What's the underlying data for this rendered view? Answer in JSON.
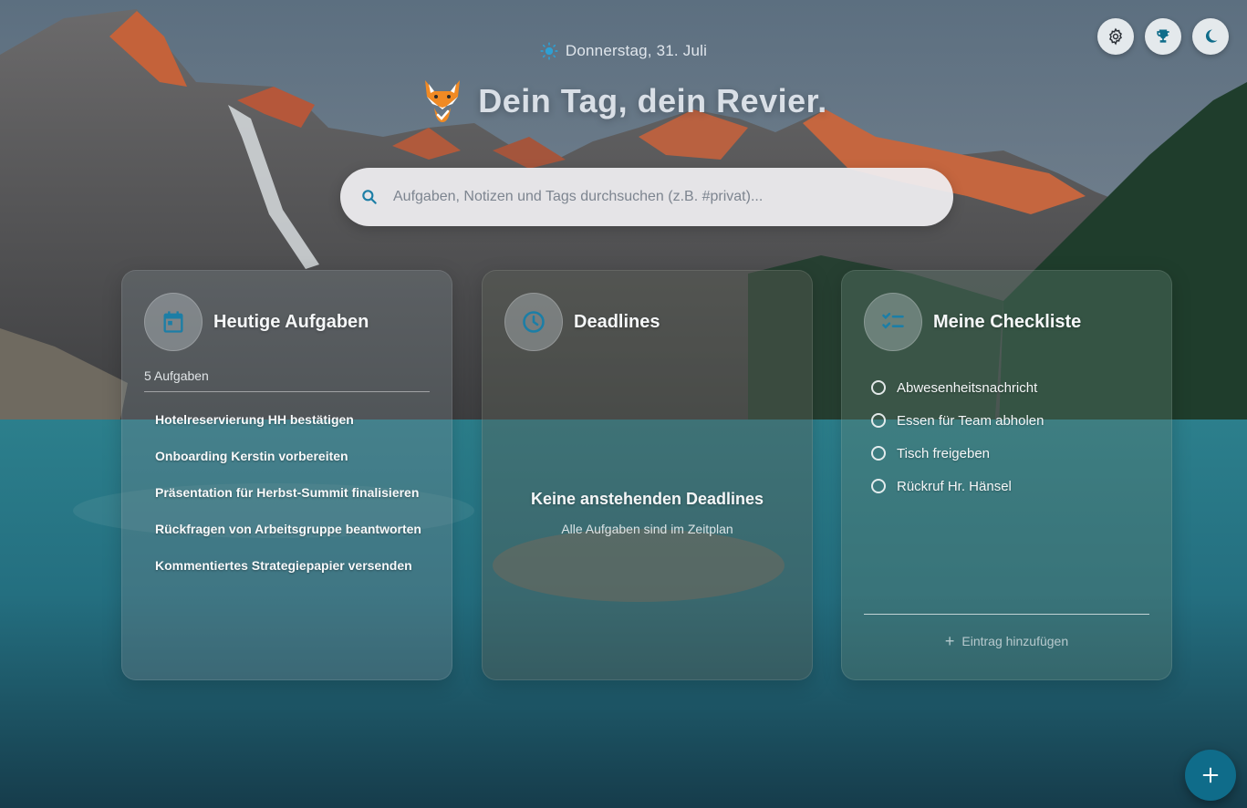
{
  "header": {
    "date": "Donnerstag, 31. Juli",
    "title": "Dein Tag, dein Revier."
  },
  "search": {
    "placeholder": "Aufgaben, Notizen und Tags durchsuchen (z.B. #privat)..."
  },
  "top_actions": [
    {
      "icon": "gear-icon"
    },
    {
      "icon": "trophy-icon"
    },
    {
      "icon": "moon-icon"
    }
  ],
  "today": {
    "title": "Heutige Aufgaben",
    "count": "5 Aufgaben",
    "tasks": [
      "Hotelreservierung HH bestätigen",
      "Onboarding Kerstin vorbereiten",
      "Präsentation für Herbst-Summit finalisieren",
      "Rückfragen von Arbeitsgruppe beantworten",
      "Kommentiertes Strategiepapier versenden"
    ]
  },
  "deadlines": {
    "title": "Deadlines",
    "empty_title": "Keine anstehenden Deadlines",
    "empty_sub": "Alle Aufgaben sind im Zeitplan"
  },
  "checklist": {
    "title": "Meine Checkliste",
    "items": [
      "Abwesenheitsnachricht",
      "Essen für Team abholen",
      "Tisch freigeben",
      "Rückruf Hr. Hänsel"
    ],
    "add_label": "Eintrag hinzufügen"
  },
  "colors": {
    "accent": "#0f6c8a",
    "icon_blue": "#1c7ea6",
    "sun": "#2f9fd2"
  }
}
